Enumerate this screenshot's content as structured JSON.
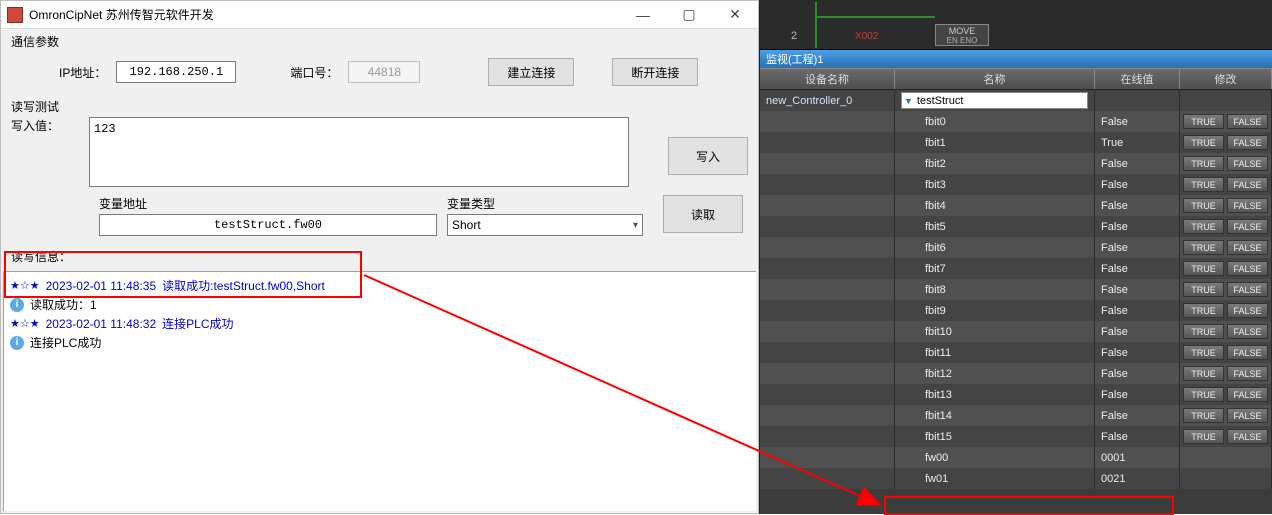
{
  "window": {
    "title": "OmronCipNet  苏州传智元软件开发",
    "min": "—",
    "max": "▢",
    "close": "✕"
  },
  "params": {
    "section_label": "通信参数",
    "ip_label": "IP地址：",
    "ip_value": "192.168.250.1",
    "port_label": "端口号：",
    "port_value": "44818",
    "connect_btn": "建立连接",
    "disconnect_btn": "断开连接"
  },
  "rw": {
    "section_label": "读写测试",
    "write_label": "写入值：",
    "write_value": "123",
    "write_btn": "写入",
    "read_btn": "读取",
    "var_addr_label": "变量地址",
    "var_addr_value": "testStruct.fw00",
    "var_type_label": "变量类型",
    "var_type_value": "Short"
  },
  "log": {
    "section_label": "读写信息：",
    "entries": [
      {
        "stars": "★☆★",
        "time": "2023-02-01 11:48:35",
        "msg": "读取成功:testStruct.fw00,Short",
        "info": "读取成功：1"
      },
      {
        "stars": "★☆★",
        "time": "2023-02-01 11:48:32",
        "msg": "连接PLC成功",
        "info": "连接PLC成功"
      }
    ]
  },
  "plc": {
    "rung_num": "2",
    "contact": "X002",
    "block_top": "MOVE",
    "block_bot": "EN  ENO"
  },
  "watch": {
    "title": "监视(工程)1",
    "headers": {
      "dev": "设备名称",
      "name": "名称",
      "val": "在线值",
      "mod": "修改"
    },
    "device": "new_Controller_0",
    "struct_name": "testStruct",
    "true_btn": "TRUE",
    "false_btn": "FALSE",
    "rows": [
      {
        "name": "fbit0",
        "value": "False",
        "btns": true
      },
      {
        "name": "fbit1",
        "value": "True",
        "btns": true
      },
      {
        "name": "fbit2",
        "value": "False",
        "btns": true
      },
      {
        "name": "fbit3",
        "value": "False",
        "btns": true
      },
      {
        "name": "fbit4",
        "value": "False",
        "btns": true
      },
      {
        "name": "fbit5",
        "value": "False",
        "btns": true
      },
      {
        "name": "fbit6",
        "value": "False",
        "btns": true
      },
      {
        "name": "fbit7",
        "value": "False",
        "btns": true
      },
      {
        "name": "fbit8",
        "value": "False",
        "btns": true
      },
      {
        "name": "fbit9",
        "value": "False",
        "btns": true
      },
      {
        "name": "fbit10",
        "value": "False",
        "btns": true
      },
      {
        "name": "fbit11",
        "value": "False",
        "btns": true
      },
      {
        "name": "fbit12",
        "value": "False",
        "btns": true
      },
      {
        "name": "fbit13",
        "value": "False",
        "btns": true
      },
      {
        "name": "fbit14",
        "value": "False",
        "btns": true
      },
      {
        "name": "fbit15",
        "value": "False",
        "btns": true
      },
      {
        "name": "fw00",
        "value": "0001",
        "btns": false
      },
      {
        "name": "fw01",
        "value": "0021",
        "btns": false
      }
    ]
  }
}
